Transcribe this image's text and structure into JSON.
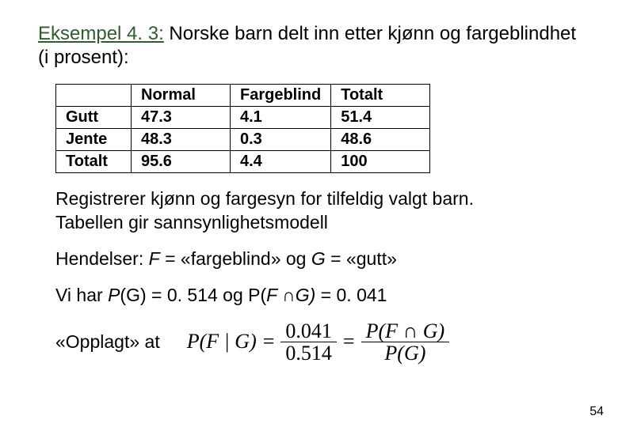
{
  "title": {
    "example_label": "Eksempel 4. 3:",
    "rest": " Norske barn delt inn etter kjønn og fargeblindhet (i prosent):"
  },
  "chart_data": {
    "type": "table",
    "columns": [
      "",
      "Normal",
      "Fargeblind",
      "Totalt"
    ],
    "rows": [
      {
        "label": "Gutt",
        "values": [
          "47.3",
          "4.1",
          "51.4"
        ]
      },
      {
        "label": "Jente",
        "values": [
          "48.3",
          "0.3",
          "48.6"
        ]
      },
      {
        "label": "Totalt",
        "values": [
          "95.6",
          "4.4",
          "100"
        ]
      }
    ]
  },
  "para1_line1": "Registrerer kjønn og fargesyn for tilfeldig valgt barn.",
  "para1_line2": "Tabellen gir sannsynlighetsmodell",
  "hendelser": {
    "lead": "Hendelser:  ",
    "F": "F",
    "eq1": " = «fargeblind» og  ",
    "G": "G",
    "eq2": " = «gutt»"
  },
  "vihar": {
    "lead": "Vi har ",
    "PG": "P",
    "PG_arg": "(G)",
    "eq_pg": " = 0. 514",
    "mid": "    og  ",
    "PFnG_lhs": "P(",
    "F": "F ",
    "cap": "∩",
    "G": "G)",
    "eq_pfng": " = 0. 041"
  },
  "opplagt": "«Opplagt» at",
  "formula": {
    "lhs": "P(F | G)",
    "eq": "=",
    "num1": "0.041",
    "den1": "0.514",
    "num2": "P(F ∩ G)",
    "den2": "P(G)"
  },
  "pagenum": "54"
}
